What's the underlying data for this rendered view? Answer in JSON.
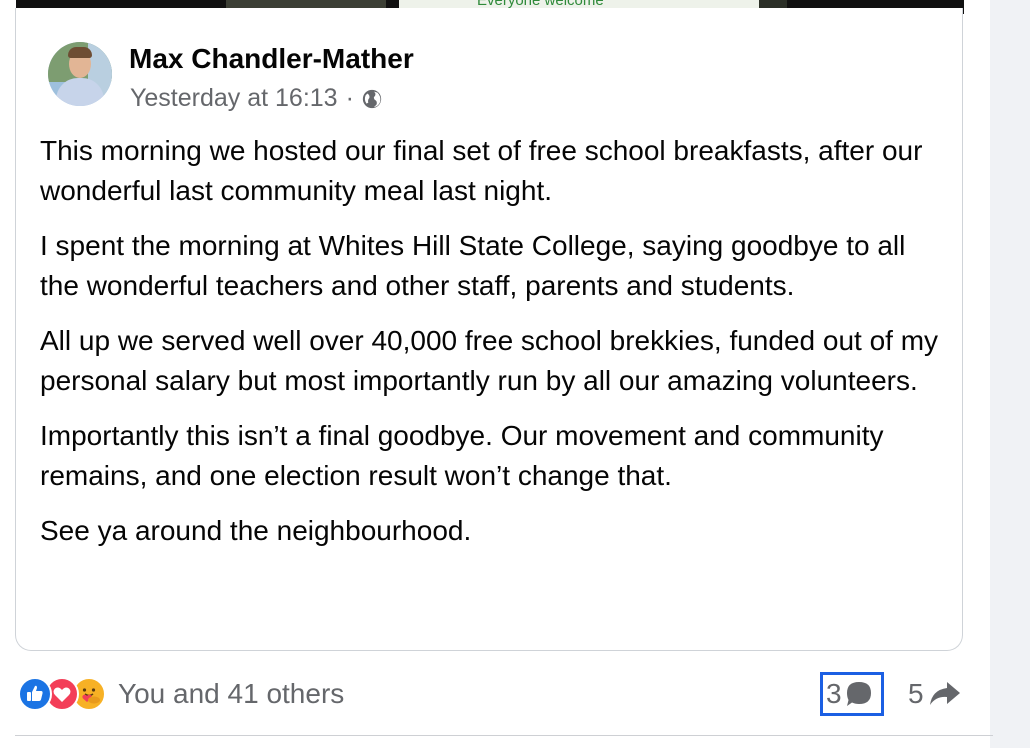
{
  "top_image": {
    "sign_text": "Everyone welcome"
  },
  "post": {
    "author": "Max Chandler-Mather",
    "timestamp": "Yesterday at 16:13",
    "separator": "·",
    "audience_icon": "globe-icon",
    "paragraphs": [
      "This morning we hosted our final set of free school breakfasts, after our wonderful last community meal last night.",
      "I spent the morning at Whites Hill State College, saying goodbye to all the wonderful teachers and other staff, parents and students.",
      "All up we served well over 40,000 free school brekkies, funded out of my personal salary but most importantly run by all our amazing volunteers.",
      "Importantly this isn’t a final goodbye. Our movement and community remains, and one election result won’t change that.",
      "See ya around the neighbourhood."
    ]
  },
  "footer": {
    "reaction_icons": [
      "like-icon",
      "love-icon",
      "care-icon"
    ],
    "reaction_text": "You and 41 others",
    "comments": "3",
    "shares": "5"
  },
  "colors": {
    "like": "#1b74e4",
    "love": "#f33e58",
    "care": "#f7b125",
    "secondary_text": "#65676b",
    "focus_outline": "#1b5fe3"
  }
}
